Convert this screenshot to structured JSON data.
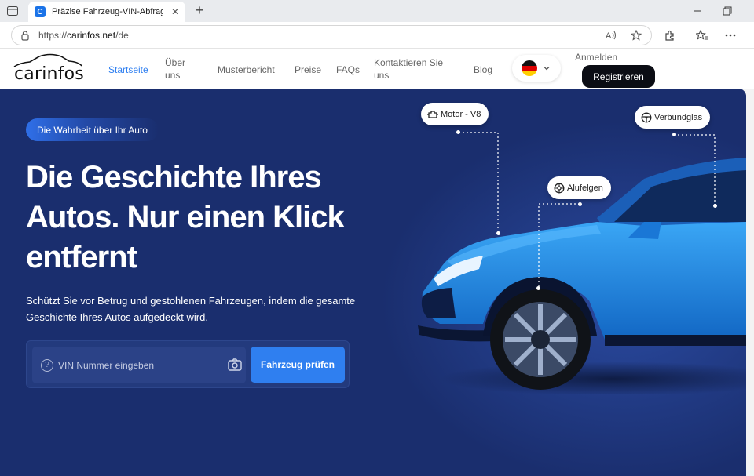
{
  "browser": {
    "tab_title": "Präzise Fahrzeug-VIN-Abfrage &",
    "tab_close": "✕",
    "new_tab": "+",
    "url_prefix": "https://",
    "url_domain": "carinfos.net",
    "url_path": "/de"
  },
  "header": {
    "logo_text": "carinfos",
    "nav": [
      {
        "label": "Startseite",
        "active": true
      },
      {
        "label": "Über uns"
      },
      {
        "label": "Musterbericht"
      },
      {
        "label": "Preise"
      },
      {
        "label": "FAQs"
      },
      {
        "label": "Kontaktieren Sie uns"
      },
      {
        "label": "Blog"
      }
    ],
    "login_label": "Anmelden",
    "register_label": "Registrieren"
  },
  "hero": {
    "badge": "Die Wahrheit über Ihr Auto",
    "headline": "Die Geschichte Ihres Autos. Nur einen Klick entfernt",
    "subtext": "Schützt Sie vor Betrug und gestohlenen Fahrzeugen, indem die gesamte Geschichte Ihres Autos aufgedeckt wird.",
    "vin_placeholder": "VIN Nummer eingeben",
    "submit_label": "Fahrzeug prüfen",
    "callouts": {
      "motor": "Motor - V8",
      "glass": "Verbundglas",
      "wheels": "Alufelgen"
    }
  },
  "colors": {
    "hero_bg": "#1a2e6e",
    "accent": "#2f7ff0",
    "car_blue": "#1f8ae0"
  }
}
